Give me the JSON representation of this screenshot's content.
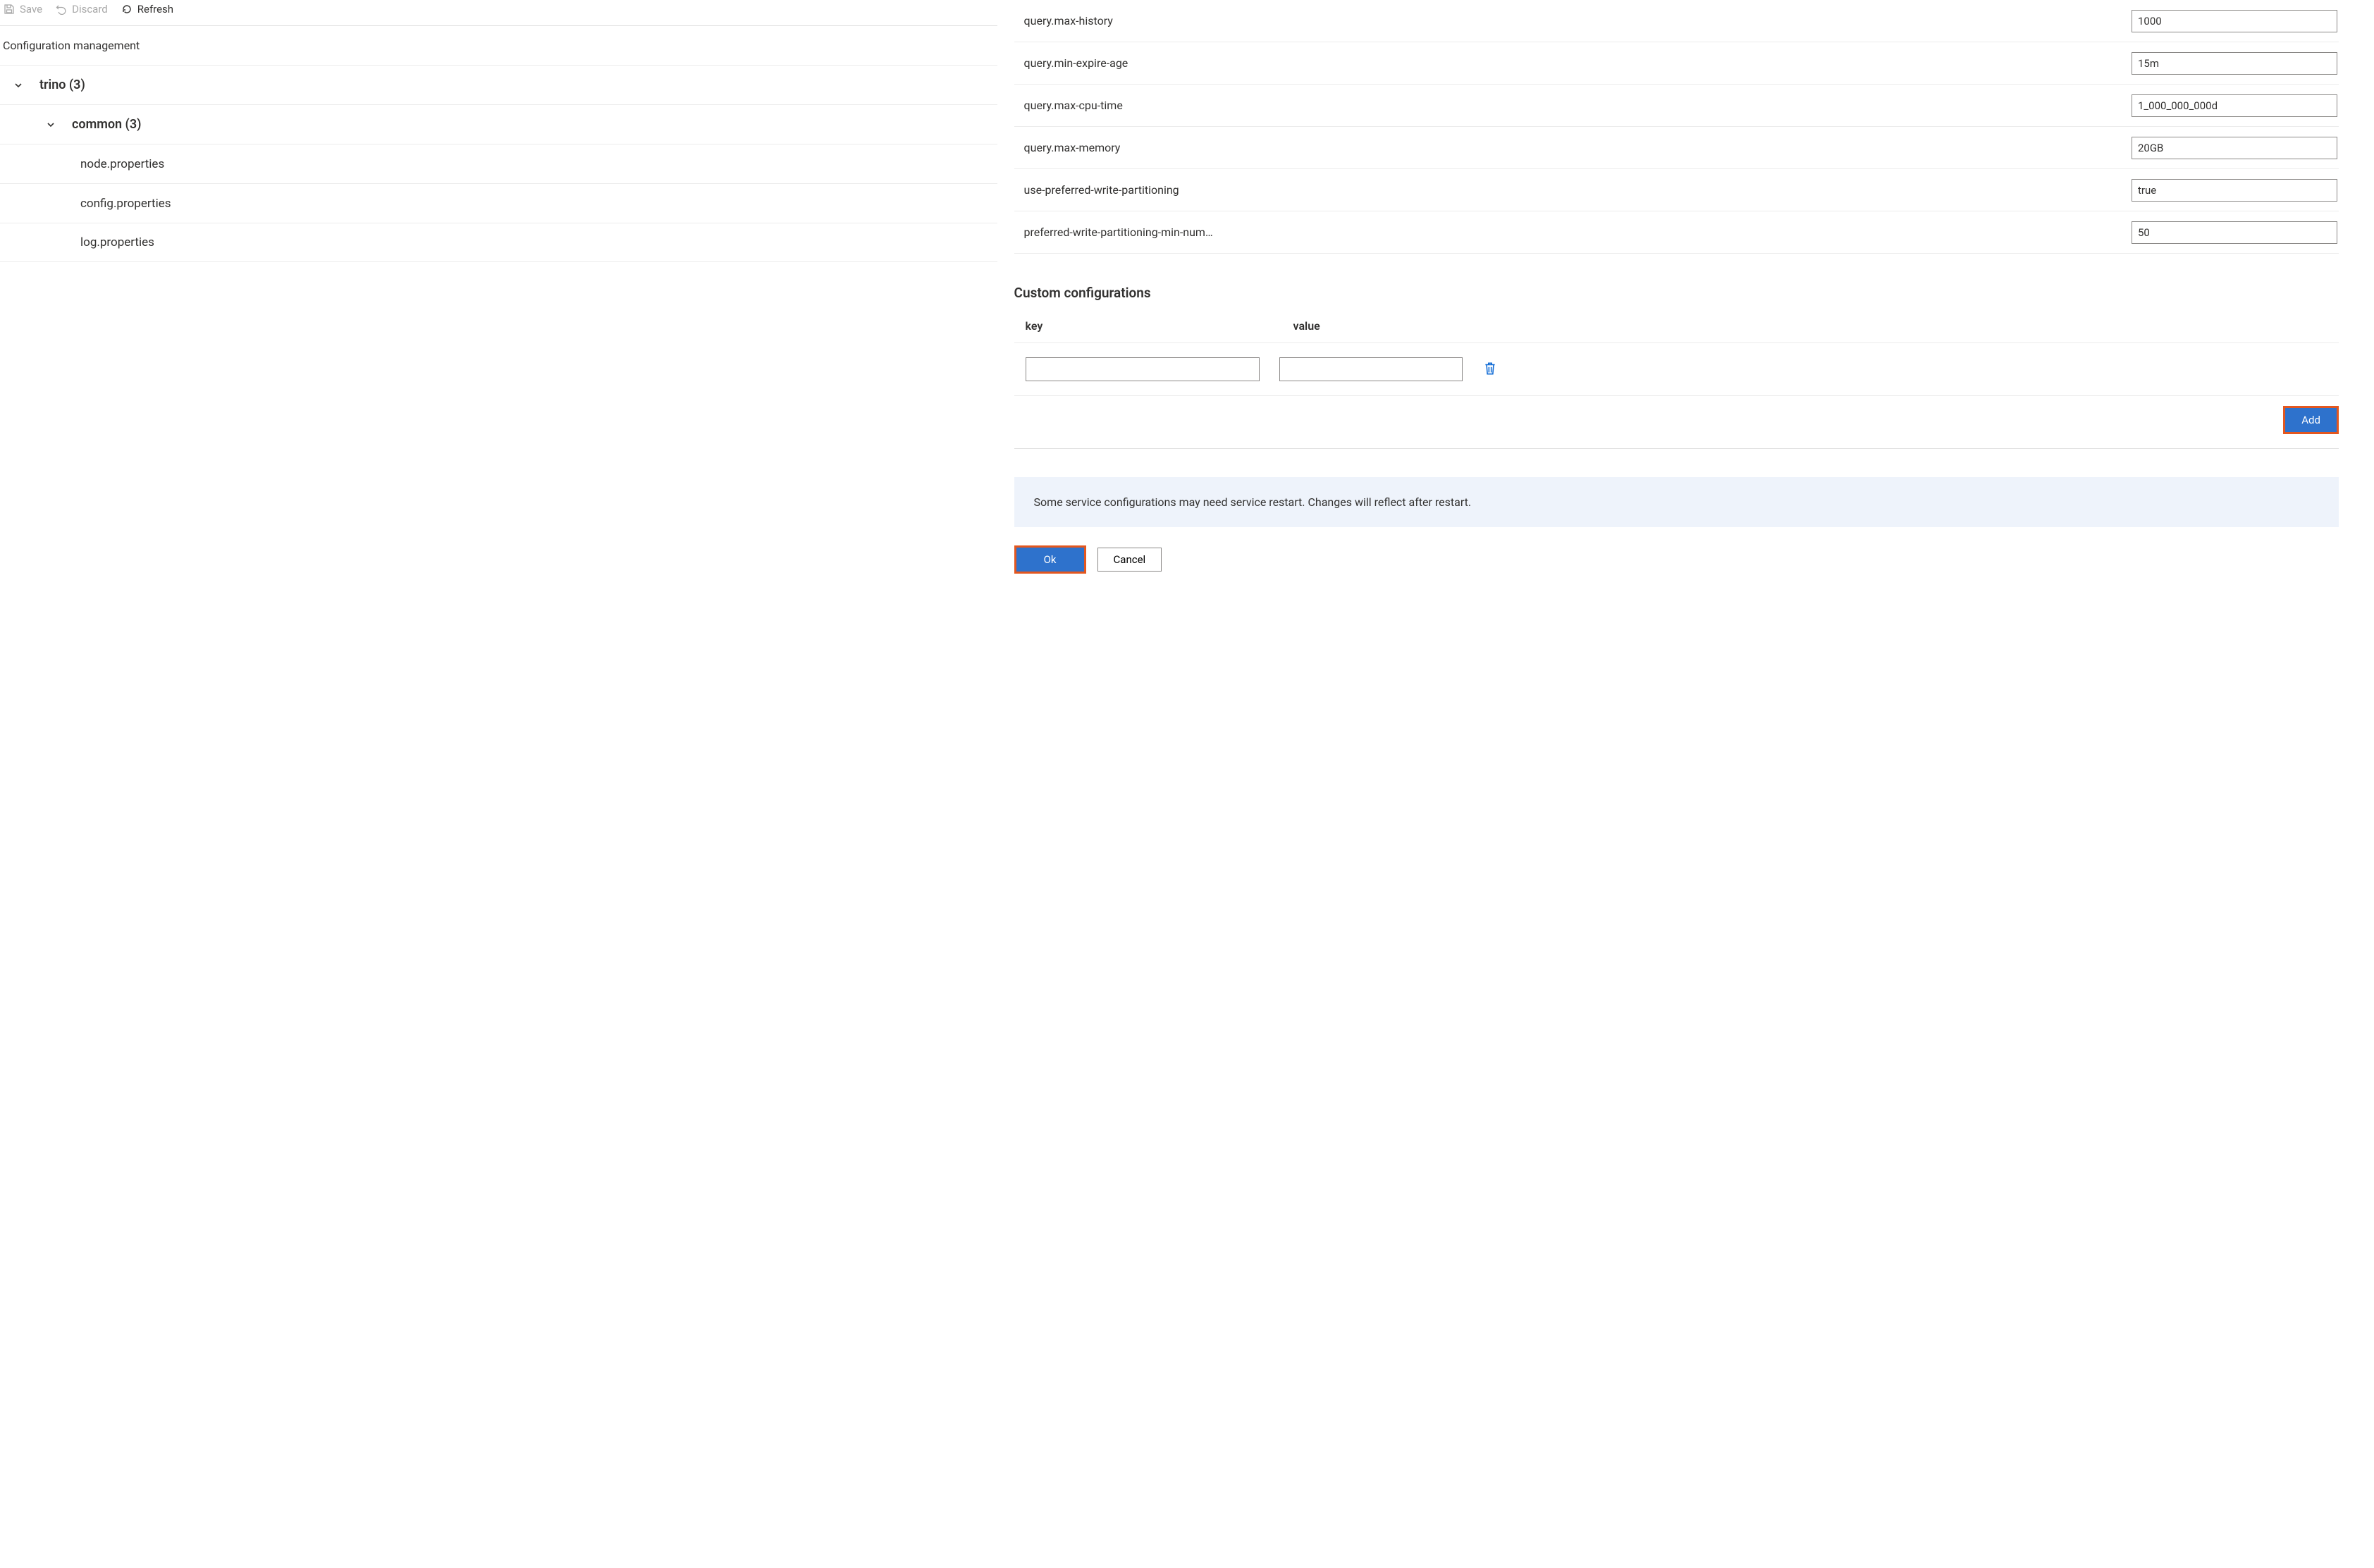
{
  "toolbar": {
    "save_label": "Save",
    "discard_label": "Discard",
    "refresh_label": "Refresh"
  },
  "section_title": "Configuration management",
  "tree": {
    "root_label": "trino (3)",
    "child_label": "common (3)",
    "leaves": [
      {
        "label": "node.properties"
      },
      {
        "label": "config.properties"
      },
      {
        "label": "log.properties"
      }
    ]
  },
  "config_rows": [
    {
      "label": "query.max-history",
      "value": "1000"
    },
    {
      "label": "query.min-expire-age",
      "value": "15m"
    },
    {
      "label": "query.max-cpu-time",
      "value": "1_000_000_000d"
    },
    {
      "label": "query.max-memory",
      "value": "20GB"
    },
    {
      "label": "use-preferred-write-partitioning",
      "value": "true"
    },
    {
      "label": "preferred-write-partitioning-min-num…",
      "value": "50"
    }
  ],
  "custom": {
    "heading": "Custom configurations",
    "key_header": "key",
    "value_header": "value",
    "row": {
      "key": "",
      "value": ""
    },
    "add_label": "Add"
  },
  "banner_text": "Some service configurations may need service restart. Changes will reflect after restart.",
  "actions": {
    "ok_label": "Ok",
    "cancel_label": "Cancel"
  }
}
